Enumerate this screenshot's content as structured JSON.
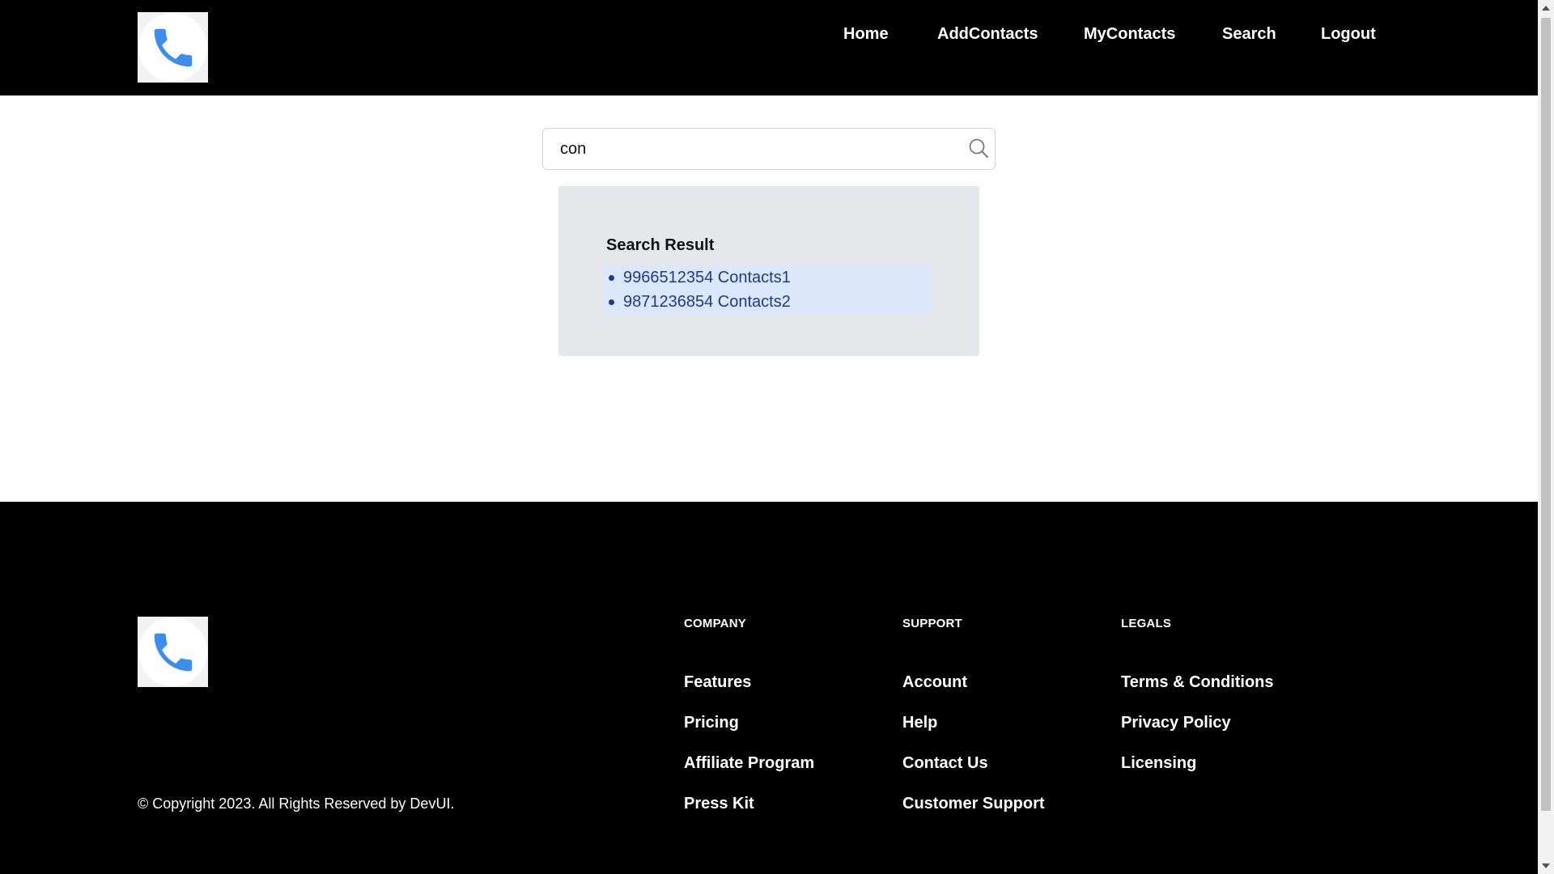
{
  "header": {
    "logo": "phone-icon",
    "nav": [
      {
        "label": "Home"
      },
      {
        "label": "AddContacts"
      },
      {
        "label": "MyContacts"
      },
      {
        "label": "Search"
      },
      {
        "label": "Logout"
      }
    ]
  },
  "search": {
    "value": "con",
    "icon": "search-icon"
  },
  "results": {
    "title": "Search Result",
    "items": [
      {
        "text": "9966512354 Contacts1"
      },
      {
        "text": "9871236854 Contacts2"
      }
    ]
  },
  "footer": {
    "logo": "phone-icon",
    "copyright": "© Copyright 2023. All Rights Reserved by DevUI.",
    "columns": [
      {
        "heading": "COMPANY",
        "links": [
          "Features",
          "Pricing",
          "Affiliate Program",
          "Press Kit"
        ]
      },
      {
        "heading": "SUPPORT",
        "links": [
          "Account",
          "Help",
          "Contact Us",
          "Customer Support"
        ]
      },
      {
        "heading": "LEGALS",
        "links": [
          "Terms & Conditions",
          "Privacy Policy",
          "Licensing"
        ]
      }
    ]
  },
  "colors": {
    "header_bg": "#000000",
    "footer_bg": "#000000",
    "result_panel_bg": "#e5e7eb",
    "result_list_bg": "#dbe7fb",
    "result_link": "#1e3a8a",
    "phone_blue": "#3b8ef0"
  }
}
